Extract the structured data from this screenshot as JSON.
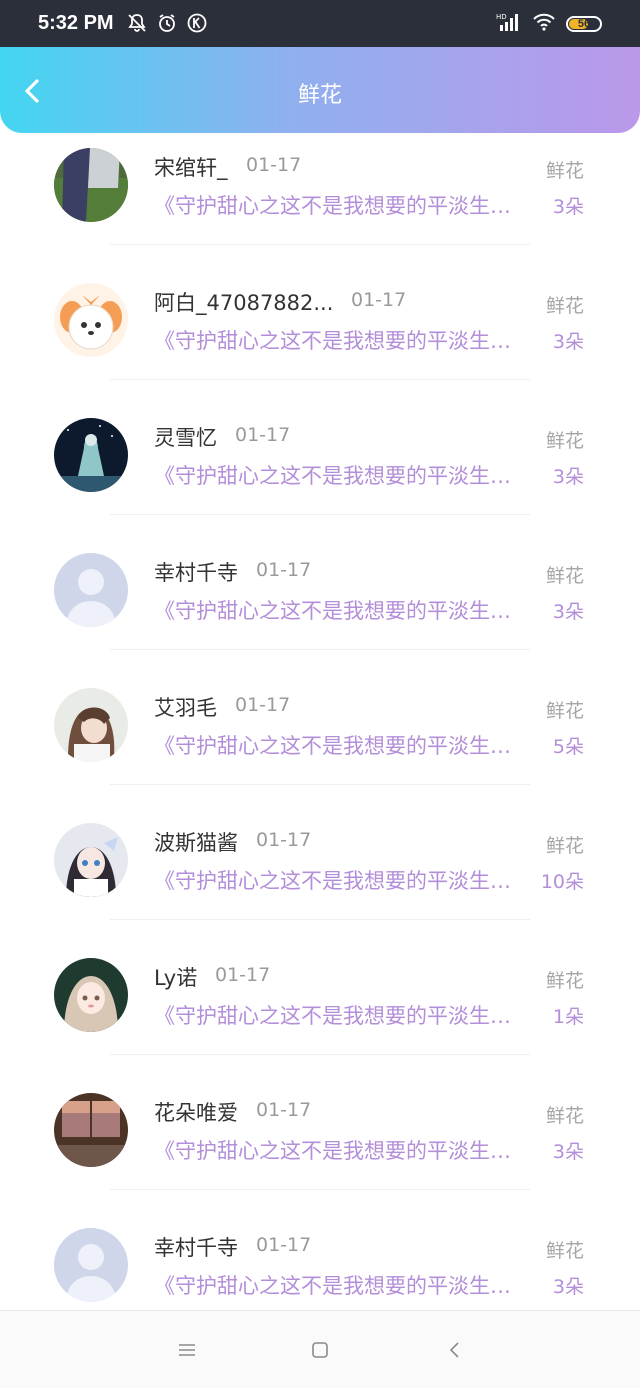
{
  "status_bar": {
    "time": "5:32 PM",
    "battery_level": "56",
    "left_icons": [
      "bell-off-icon",
      "alarm-icon",
      "k-badge-icon"
    ],
    "right_icons": [
      "hd-signal-icon",
      "wifi-icon",
      "battery-icon"
    ]
  },
  "header": {
    "title": "鲜花",
    "back_icon": "chevron-left-icon",
    "gradient": [
      "#43d6f1",
      "#8fb0ef",
      "#bb98ea"
    ]
  },
  "colors": {
    "accent_purple": "#b38ed9",
    "meta_gray": "#9a9a9a"
  },
  "list": {
    "items": [
      {
        "name": "宋绾轩_",
        "date": "01-17",
        "message": "《守护甜心之这不是我想要的平淡生活》",
        "gift": "鲜花",
        "count": "3朵",
        "avatar": "photo-grass"
      },
      {
        "name": "阿白_47087882...",
        "date": "01-17",
        "message": "《守护甜心之这不是我想要的平淡生活》",
        "gift": "鲜花",
        "count": "3朵",
        "avatar": "cartoon-dog"
      },
      {
        "name": "灵雪忆",
        "date": "01-17",
        "message": "《守护甜心之这不是我想要的平淡生活》",
        "gift": "鲜花",
        "count": "3朵",
        "avatar": "night-scene"
      },
      {
        "name": "幸村千寺",
        "date": "01-17",
        "message": "《守护甜心之这不是我想要的平淡生活》",
        "gift": "鲜花",
        "count": "3朵",
        "avatar": "default-user"
      },
      {
        "name": "艾羽毛",
        "date": "01-17",
        "message": "《守护甜心之这不是我想要的平淡生活》",
        "gift": "鲜花",
        "count": "5朵",
        "avatar": "anime-girl-light"
      },
      {
        "name": "波斯猫酱",
        "date": "01-17",
        "message": "《守护甜心之这不是我想要的平淡生活》",
        "gift": "鲜花",
        "count": "10朵",
        "avatar": "anime-girl-bow"
      },
      {
        "name": "Ly诺",
        "date": "01-17",
        "message": "《守护甜心之这不是我想要的平淡生活》",
        "gift": "鲜花",
        "count": "1朵",
        "avatar": "anime-girl-dark"
      },
      {
        "name": "花朵唯爱",
        "date": "01-17",
        "message": "《守护甜心之这不是我想要的平淡生活》",
        "gift": "鲜花",
        "count": "3朵",
        "avatar": "sunset-room"
      },
      {
        "name": "幸村千寺",
        "date": "01-17",
        "message": "《守护甜心之这不是我想要的平淡生活》",
        "gift": "鲜花",
        "count": "3朵",
        "avatar": "default-user"
      }
    ]
  },
  "nav_bar": {
    "icons": [
      "menu-icon",
      "home-icon",
      "back-icon"
    ]
  }
}
